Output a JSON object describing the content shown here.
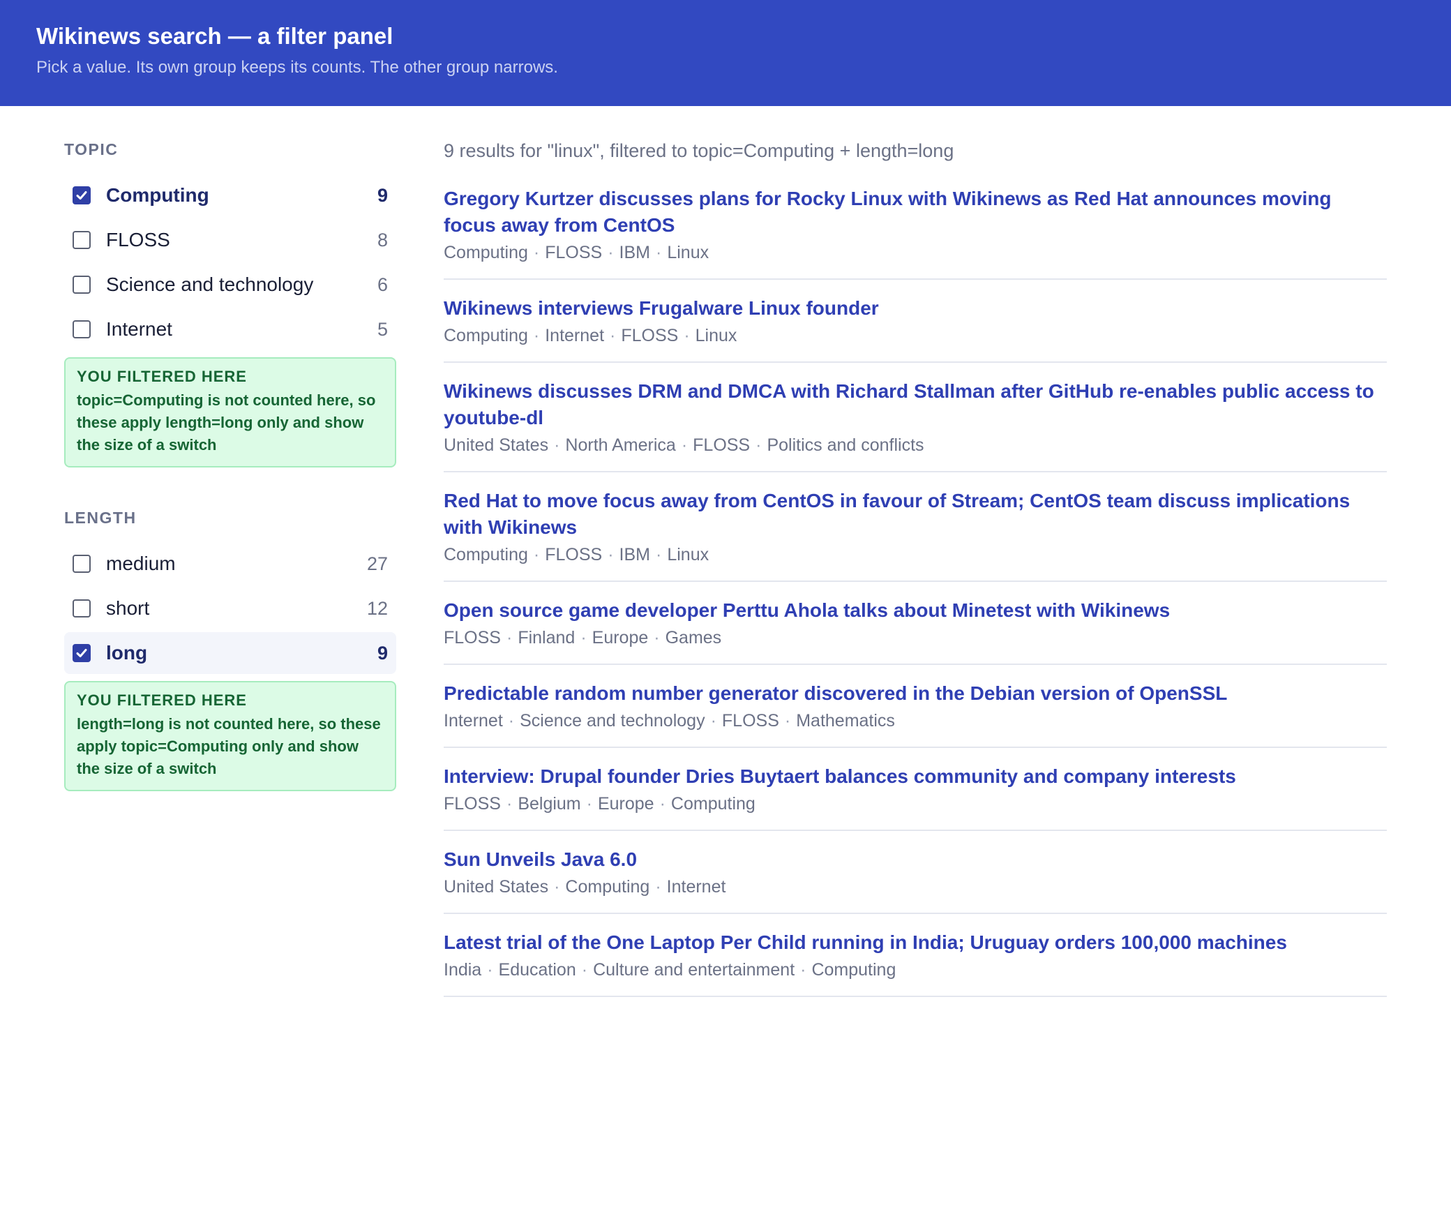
{
  "header": {
    "title": "Wikinews search — a filter panel",
    "subtitle": "Pick a value. Its own group keeps its counts. The other group narrows."
  },
  "facets": {
    "topic": {
      "title": "TOPIC",
      "items": [
        {
          "label": "Computing",
          "count": "9",
          "checked": true
        },
        {
          "label": "FLOSS",
          "count": "8",
          "checked": false
        },
        {
          "label": "Science and technology",
          "count": "6",
          "checked": false
        },
        {
          "label": "Internet",
          "count": "5",
          "checked": false
        }
      ],
      "note": {
        "title": "YOU FILTERED HERE",
        "body": "topic=Computing is not counted here, so these apply length=long only and show the size of a switch"
      }
    },
    "length": {
      "title": "LENGTH",
      "items": [
        {
          "label": "medium",
          "count": "27",
          "checked": false
        },
        {
          "label": "short",
          "count": "12",
          "checked": false
        },
        {
          "label": "long",
          "count": "9",
          "checked": true
        }
      ],
      "note": {
        "title": "YOU FILTERED HERE",
        "body": "length=long is not counted here, so these apply topic=Computing only and show the size of a switch"
      }
    }
  },
  "results": {
    "summary": "9 results for \"linux\", filtered to topic=Computing + length=long",
    "items": [
      {
        "title": "Gregory Kurtzer discusses plans for Rocky Linux with Wikinews as Red Hat announces moving focus away from CentOS",
        "tags": [
          "Computing",
          "FLOSS",
          "IBM",
          "Linux"
        ]
      },
      {
        "title": "Wikinews interviews Frugalware Linux founder",
        "tags": [
          "Computing",
          "Internet",
          "FLOSS",
          "Linux"
        ]
      },
      {
        "title": "Wikinews discusses DRM and DMCA with Richard Stallman after GitHub re-enables public access to youtube-dl",
        "tags": [
          "United States",
          "North America",
          "FLOSS",
          "Politics and conflicts"
        ]
      },
      {
        "title": "Red Hat to move focus away from CentOS in favour of Stream; CentOS team discuss implications with Wikinews",
        "tags": [
          "Computing",
          "FLOSS",
          "IBM",
          "Linux"
        ]
      },
      {
        "title": "Open source game developer Perttu Ahola talks about Minetest with Wikinews",
        "tags": [
          "FLOSS",
          "Finland",
          "Europe",
          "Games"
        ]
      },
      {
        "title": "Predictable random number generator discovered in the Debian version of OpenSSL",
        "tags": [
          "Internet",
          "Science and technology",
          "FLOSS",
          "Mathematics"
        ]
      },
      {
        "title": "Interview: Drupal founder Dries Buytaert balances community and company interests",
        "tags": [
          "FLOSS",
          "Belgium",
          "Europe",
          "Computing"
        ]
      },
      {
        "title": "Sun Unveils Java 6.0",
        "tags": [
          "United States",
          "Computing",
          "Internet"
        ]
      },
      {
        "title": "Latest trial of the One Laptop Per Child running in India; Uruguay orders 100,000 machines",
        "tags": [
          "India",
          "Education",
          "Culture and entertainment",
          "Computing"
        ]
      }
    ]
  }
}
